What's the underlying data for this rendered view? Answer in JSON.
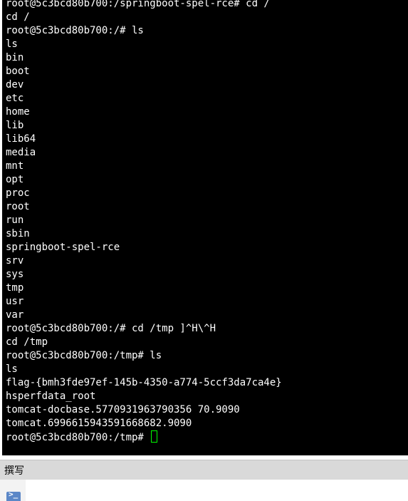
{
  "terminal": {
    "lines": [
      "root@5c3bcd80b700:/springboot-spel-rce# cd /",
      "cd /",
      "root@5c3bcd80b700:/# ls",
      "ls",
      "bin",
      "boot",
      "dev",
      "etc",
      "home",
      "lib",
      "lib64",
      "media",
      "mnt",
      "opt",
      "proc",
      "root",
      "run",
      "sbin",
      "springboot-spel-rce",
      "srv",
      "sys",
      "tmp",
      "usr",
      "var",
      "root@5c3bcd80b700:/# cd /tmp ]^H\\^H",
      "cd /tmp",
      "root@5c3bcd80b700:/tmp# ls",
      "ls",
      "flag-{bmh3fde97ef-145b-4350-a774-5ccf3da7ca4e}",
      "hsperfdata_root",
      "tomcat-docbase.5770931963790356 70.9090",
      "tomcat.6996615943591668682.9090"
    ],
    "prompt": "root@5c3bcd80b700:/tmp# ",
    "colors": {
      "background": "#000000",
      "text": "#ffffff",
      "cursor": "#00ff00"
    }
  },
  "compose": {
    "label": "撰写",
    "icon": "terminal-prompt-icon"
  }
}
